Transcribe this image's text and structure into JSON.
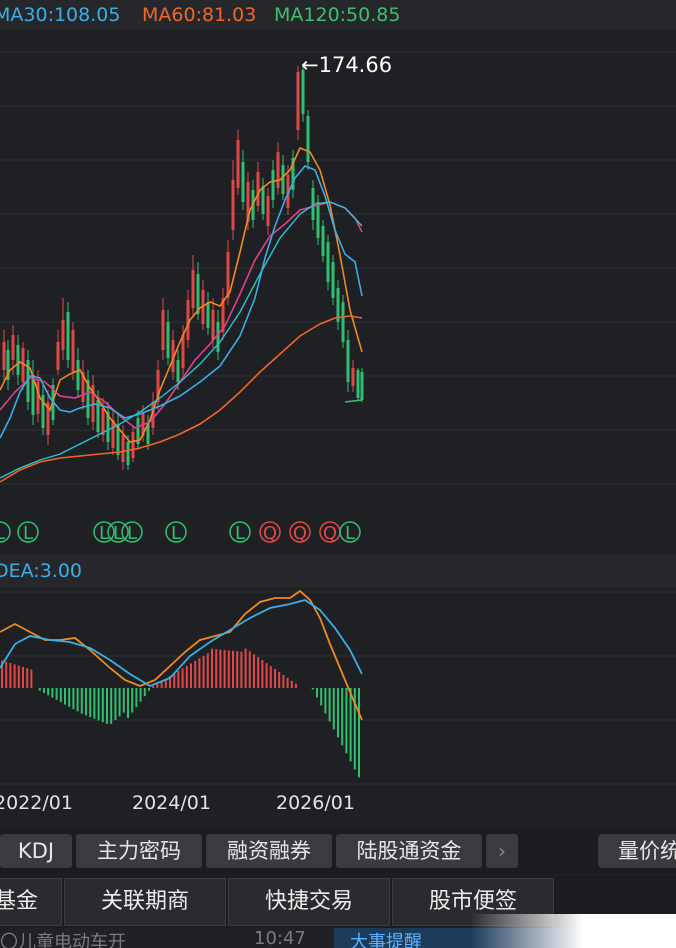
{
  "ma_legend": {
    "ma30": "MA30:108.05",
    "ma60": "MA60:81.03",
    "ma120": "MA120:50.85"
  },
  "price_chart": {
    "high_label": "←174.66",
    "markers": [
      "L",
      "L",
      "L",
      "L",
      "L",
      "L",
      "L",
      "Q",
      "Q",
      "Q",
      "L",
      "Q"
    ]
  },
  "macd": {
    "dea_label": "DEA:3.00"
  },
  "x_axis": {
    "dates": [
      "2022/01",
      "2024/01",
      "2026/01"
    ]
  },
  "toolbar": {
    "tabs": [
      "KDJ",
      "主力密码",
      "融资融券",
      "陆股通资金"
    ],
    "arrow": "›",
    "right_tab": "量价统"
  },
  "bottom_nav": {
    "items": [
      "基金",
      "关联期商",
      "快捷交易",
      "股市便签"
    ]
  },
  "news": {
    "text": "〇儿童电动车开",
    "time": "10:47",
    "alert": "大事提醒"
  },
  "colors": {
    "up": "#e04848",
    "down": "#2fbf71",
    "ma5": "#f08a24",
    "ma10": "#e0408c",
    "ma20": "#3aaee8",
    "ma30": "#3aaee8",
    "ma60": "#f0662a",
    "ma120": "#3fbf6e"
  }
}
